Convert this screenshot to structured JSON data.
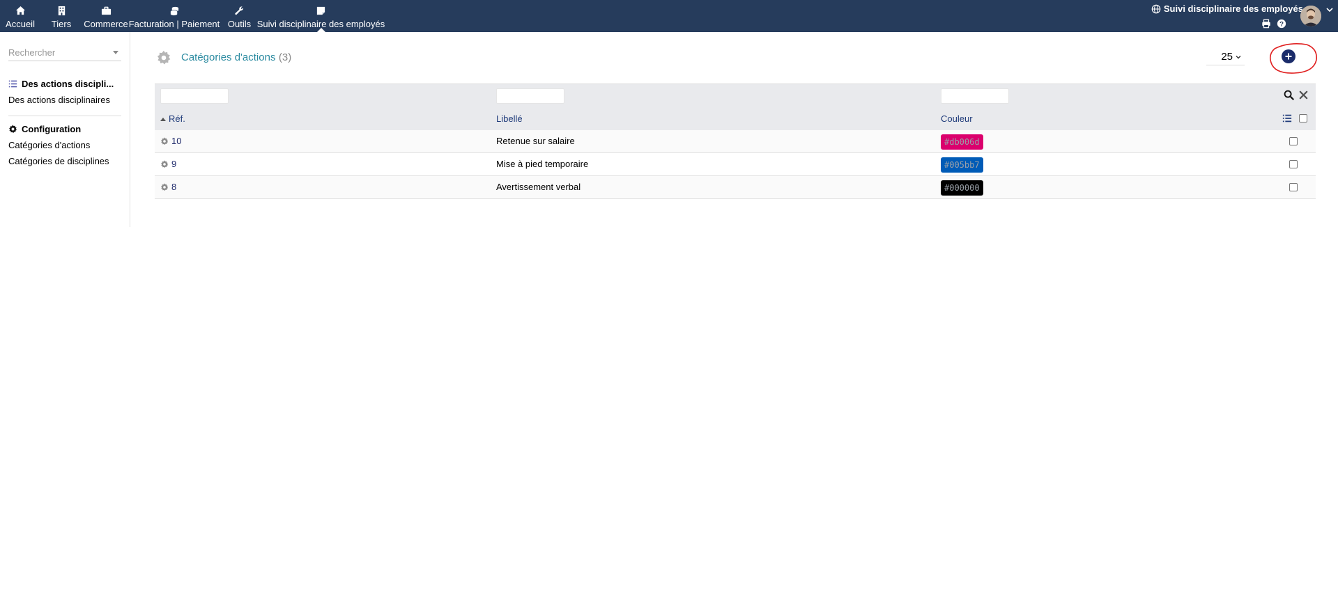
{
  "topbar": {
    "nav": [
      {
        "label": "Accueil",
        "icon": "home-icon"
      },
      {
        "label": "Tiers",
        "icon": "building-icon"
      },
      {
        "label": "Commerce",
        "icon": "briefcase-icon"
      },
      {
        "label": "Facturation | Paiement",
        "icon": "coins-icon"
      },
      {
        "label": "Outils",
        "icon": "wrench-icon"
      },
      {
        "label": "Suivi disciplinaire des employés",
        "icon": "note-icon"
      }
    ],
    "module_title": "Suivi disciplinaire des employés"
  },
  "sidebar": {
    "search_placeholder": "Rechercher",
    "sections": [
      {
        "title": "Des actions discipli...",
        "icon": "list-icon",
        "links": [
          "Des actions disciplinaires"
        ]
      },
      {
        "title": "Configuration",
        "icon": "gear-icon",
        "links": [
          "Catégories d'actions",
          "Catégories de disciplines"
        ]
      }
    ]
  },
  "main": {
    "title": "Catégories d'actions",
    "count": "(3)",
    "page_size": "25"
  },
  "table": {
    "columns": [
      "Réf.",
      "Libellé",
      "Couleur"
    ],
    "rows": [
      {
        "ref": "10",
        "label": "Retenue sur salaire",
        "color": "#db006d"
      },
      {
        "ref": "9",
        "label": "Mise à pied temporaire",
        "color": "#005bb7"
      },
      {
        "ref": "8",
        "label": "Avertissement verbal",
        "color": "#000000"
      }
    ]
  },
  "colors": {
    "topbar_bg": "#263c5c",
    "title_color": "#2a8aa0",
    "add_button": "#1a2b6a",
    "annotation_circle": "#e02020"
  }
}
